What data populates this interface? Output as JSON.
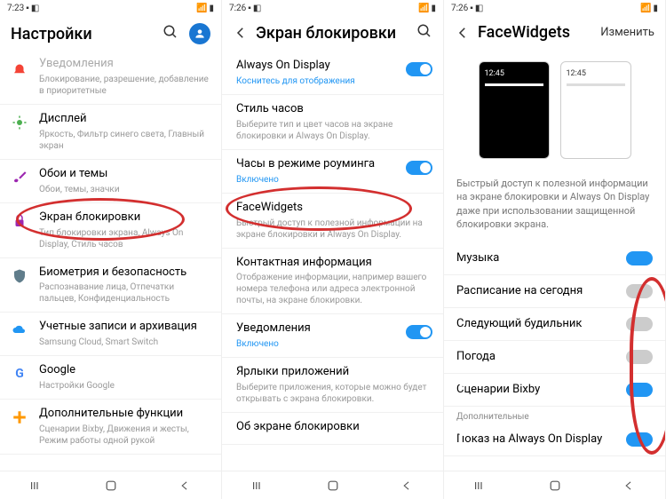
{
  "s1": {
    "time": "7:23",
    "title": "Настройки",
    "items": [
      {
        "icon": "#f44336",
        "title": "Уведомления",
        "sub": "Блокирование, разрешение, добавление в приоритетные"
      },
      {
        "icon": "#4caf50",
        "title": "Дисплей",
        "sub": "Яркость, Фильтр синего света, Главный экран"
      },
      {
        "icon": "#9c27b0",
        "title": "Обои и темы",
        "sub": "Обои, темы, значки"
      },
      {
        "icon": "#9c27b0",
        "title": "Экран блокировки",
        "sub": "Тип блокировки экрана, Always On Display, Стиль часов"
      },
      {
        "icon": "#607d8b",
        "title": "Биометрия и безопасность",
        "sub": "Распознавание лица, Отпечатки пальцев, Конфиденциальность"
      },
      {
        "icon": "#2196f3",
        "title": "Учетные записи и архивация",
        "sub": "Samsung Cloud, Smart Switch"
      },
      {
        "icon": "#4285f4",
        "title": "Google",
        "sub": "Настройки Google"
      },
      {
        "icon": "#ff9800",
        "title": "Дополнительные функции",
        "sub": "Сценарии Bixby, Движения и жесты, Режим работы одной рукой"
      }
    ]
  },
  "s2": {
    "time": "7:26",
    "title": "Экран блокировки",
    "items": [
      {
        "title": "Always On Display",
        "sub": "Коснитесь для отображения",
        "subBlue": true,
        "toggle": true
      },
      {
        "title": "Стиль часов",
        "sub": "Выберите тип и цвет часов на экране блокировки и Always On Display."
      },
      {
        "title": "Часы в режиме роуминга",
        "sub": "Включено",
        "subBlue": true,
        "toggle": true
      },
      {
        "title": "FaceWidgets",
        "sub": "Быстрый доступ к полезной информации на экране блокировки и Always On Display."
      },
      {
        "title": "Контактная информация",
        "sub": "Отображение информации, например вашего номера телефона или адреса электронной почты, на экране блокировки."
      },
      {
        "title": "Уведомления",
        "sub": "Включено",
        "subBlue": true,
        "toggle": true
      },
      {
        "title": "Ярлыки приложений",
        "sub": "Выберите приложения, которые можно будет открывать с экрана блокировки."
      },
      {
        "title": "Об экране блокировки",
        "sub": ""
      }
    ]
  },
  "s3": {
    "time": "7:26",
    "title": "FaceWidgets",
    "edit": "Изменить",
    "previewTime": "12:45",
    "desc": "Быстрый доступ к полезной информации на экране блокировки и Always On Display даже при использовании защищенной блокировки экрана.",
    "items": [
      {
        "title": "Музыка",
        "on": true
      },
      {
        "title": "Расписание на сегодня",
        "on": false
      },
      {
        "title": "Следующий будильник",
        "on": false
      },
      {
        "title": "Погода",
        "on": false
      },
      {
        "title": "Сценарии Bixby",
        "on": true
      }
    ],
    "extra_label": "Дополнительные",
    "extra": {
      "title": "Показ на Always On Display",
      "on": true
    }
  }
}
